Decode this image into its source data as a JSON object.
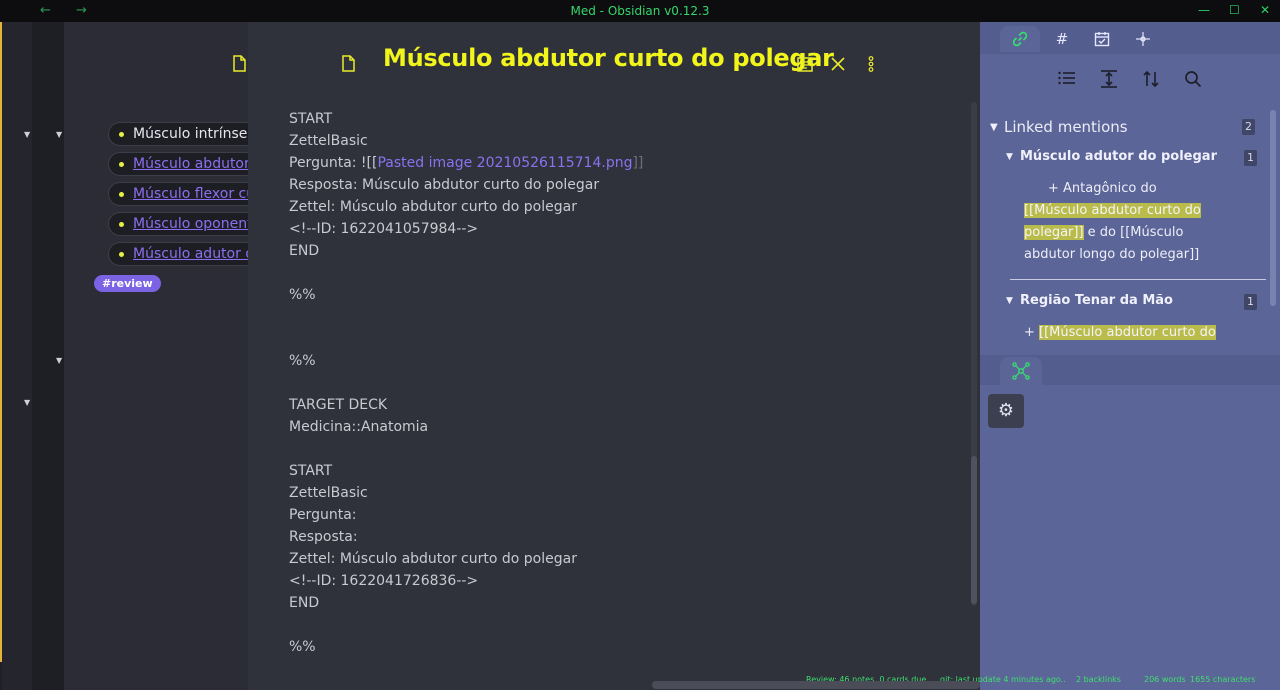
{
  "window": {
    "title": "Med - Obsidian v0.12.3",
    "back_icon": "←",
    "forward_icon": "→",
    "minimize_icon": "—",
    "maximize_icon": "☐",
    "close_icon": "✕"
  },
  "outline": {
    "items": [
      {
        "label": "Músculo intrínseco",
        "link": false
      },
      {
        "label": "Músculo abdutor curto do polegar",
        "link": true
      },
      {
        "label": "Músculo flexor curto do polegar",
        "link": true
      },
      {
        "label": "Músculo oponente do polegar",
        "link": true
      },
      {
        "label": "Músculo adutor do polegar",
        "link": true
      }
    ],
    "tag": "#review"
  },
  "editor": {
    "title": "Músculo abdutor curto do polegar",
    "lines": [
      {
        "text": "START"
      },
      {
        "text": "ZettelBasic"
      },
      {
        "prefix": "Pergunta: ![[",
        "link": "Pasted image 20210526115714.png",
        "suffix": "]]"
      },
      {
        "text": "Resposta: Músculo abdutor curto do polegar"
      },
      {
        "text": "Zettel: Músculo abdutor curto do polegar"
      },
      {
        "text": "<!--ID: 1622041057984-->"
      },
      {
        "text": "END"
      },
      {
        "text": ""
      },
      {
        "text": "%%"
      },
      {
        "text": ""
      },
      {
        "text": ""
      },
      {
        "text": "%%"
      },
      {
        "text": ""
      },
      {
        "text": "TARGET DECK"
      },
      {
        "text": "Medicina::Anatomia"
      },
      {
        "text": ""
      },
      {
        "text": "START"
      },
      {
        "text": "ZettelBasic"
      },
      {
        "text": "Pergunta:"
      },
      {
        "text": "Resposta:"
      },
      {
        "text": "Zettel: Músculo abdutor curto do polegar"
      },
      {
        "text": "<!--ID: 1622041726836-->"
      },
      {
        "text": "END"
      },
      {
        "text": ""
      },
      {
        "text": "%%"
      }
    ]
  },
  "backlinks": {
    "heading": "Linked mentions",
    "count": "2",
    "groups": [
      {
        "title": "Músculo adutor do polegar",
        "count": "1",
        "pre": "+ Antagônico do ",
        "highlight": "[[Músculo abdutor curto do polegar]]",
        "post": " e do [[Músculo abdutor longo do polegar]]"
      },
      {
        "title": "Região Tenar da Mão",
        "count": "1",
        "pre": "+ ",
        "highlight": "[[Músculo abdutor curto do",
        "post": ""
      }
    ]
  },
  "status_bar": {
    "review": "Review: 46 notes, 0 cards due",
    "git": "git: last update 4 minutes ago..",
    "backlinks": "2 backlinks",
    "words": "206 words",
    "characters": "1655 characters"
  },
  "colors": {
    "accent_green": "#35d66b",
    "title_yellow": "#f2f51c",
    "link_purple": "#8a72f0",
    "panel_blue": "#5b6598"
  }
}
